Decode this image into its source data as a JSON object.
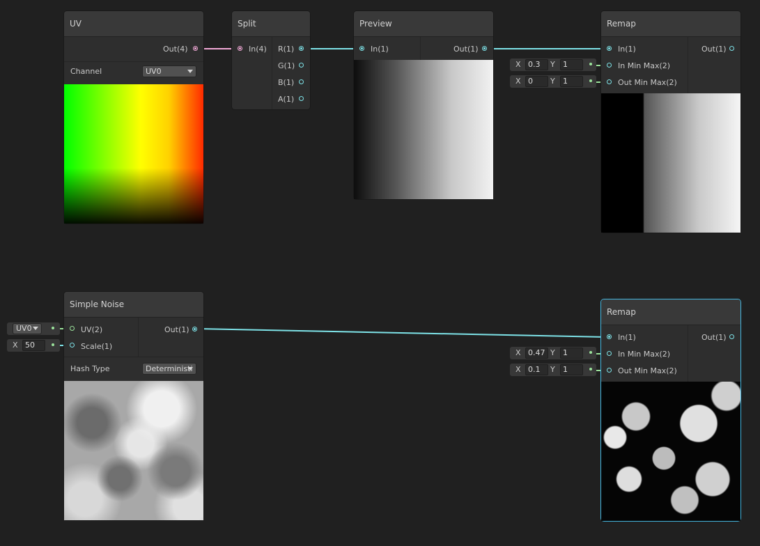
{
  "nodes": {
    "uv": {
      "title": "UV",
      "out_label": "Out(4)",
      "channel_label": "Channel",
      "channel_value": "UV0"
    },
    "split": {
      "title": "Split",
      "in_label": "In(4)",
      "outputs": [
        "R(1)",
        "G(1)",
        "B(1)",
        "A(1)"
      ]
    },
    "preview": {
      "title": "Preview",
      "in_label": "In(1)",
      "out_label": "Out(1)"
    },
    "remap_top": {
      "title": "Remap",
      "in_label": "In(1)",
      "in_minmax_label": "In Min Max(2)",
      "out_minmax_label": "Out Min Max(2)",
      "out_label": "Out(1)",
      "in_minmax": {
        "x_label": "X",
        "x": "0.3",
        "y_label": "Y",
        "y": "1"
      },
      "out_minmax": {
        "x_label": "X",
        "x": "0",
        "y_label": "Y",
        "y": "1"
      }
    },
    "simple_noise": {
      "title": "Simple Noise",
      "uv_label": "UV(2)",
      "scale_label": "Scale(1)",
      "out_label": "Out(1)",
      "hash_type_label": "Hash Type",
      "hash_type_value": "Deterministi",
      "uv_input_value": "UV0",
      "scale_axis": "X",
      "scale_value": "50"
    },
    "remap_bottom": {
      "title": "Remap",
      "in_label": "In(1)",
      "in_minmax_label": "In Min Max(2)",
      "out_minmax_label": "Out Min Max(2)",
      "out_label": "Out(1)",
      "in_minmax": {
        "x_label": "X",
        "x": "0.47",
        "y_label": "Y",
        "y": "1"
      },
      "out_minmax": {
        "x_label": "X",
        "x": "0.1",
        "y_label": "Y",
        "y": "1"
      }
    }
  },
  "colors": {
    "wire_float": "#7ee3e8",
    "wire_vector4": "#f2a9d7",
    "wire_vector2": "#9be39b",
    "selection": "#44b6e0"
  }
}
